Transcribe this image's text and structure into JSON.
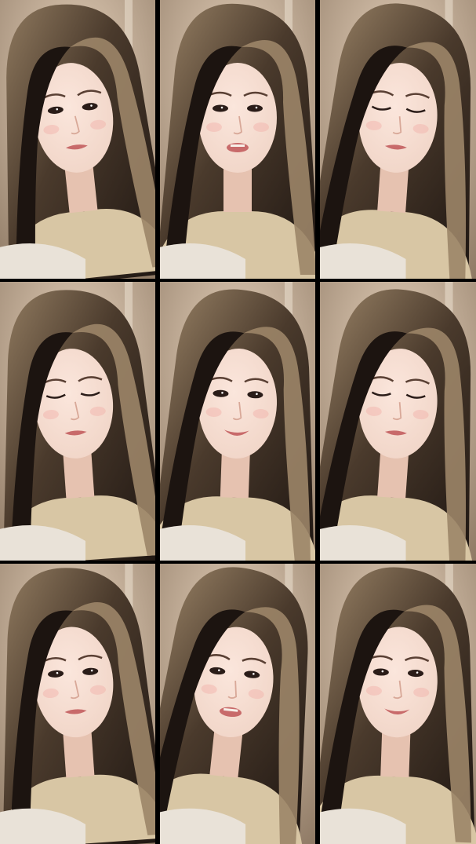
{
  "collage": {
    "layout": "3x3 grid",
    "frame_count": 9,
    "frames": [
      {
        "subject": "portrait-frame",
        "expression": "neutral-looking-down",
        "lighting": "warm"
      },
      {
        "subject": "portrait-frame",
        "expression": "talking",
        "lighting": "warm"
      },
      {
        "subject": "portrait-frame",
        "expression": "eyes-closed",
        "lighting": "warm"
      },
      {
        "subject": "portrait-frame",
        "expression": "looking-down",
        "lighting": "warm"
      },
      {
        "subject": "portrait-frame",
        "expression": "smiling",
        "lighting": "warm"
      },
      {
        "subject": "portrait-frame",
        "expression": "looking-down",
        "lighting": "warm"
      },
      {
        "subject": "portrait-frame",
        "expression": "neutral",
        "lighting": "warm"
      },
      {
        "subject": "portrait-frame",
        "expression": "looking-aside",
        "lighting": "warm"
      },
      {
        "subject": "portrait-frame",
        "expression": "soft-smile",
        "lighting": "warm"
      }
    ],
    "colors": {
      "divider": "#000000",
      "wall": "#c9b39a",
      "hair_dark": "#1c1410",
      "hair_highlight": "#9c8568",
      "skin": "#f0d4c6",
      "lips": "#c86a6a",
      "top": "#d8c6a4"
    }
  }
}
